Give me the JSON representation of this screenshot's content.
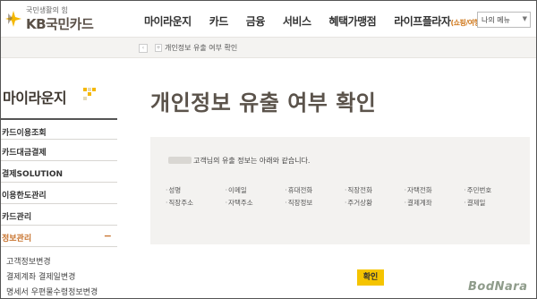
{
  "header": {
    "logo_slogan": "국민생활의 힘",
    "logo_name": "KB국민카드",
    "nav": [
      {
        "label": "마이라운지"
      },
      {
        "label": "카드"
      },
      {
        "label": "금융"
      },
      {
        "label": "서비스"
      },
      {
        "label": "혜택가맹점"
      },
      {
        "label": "라이프플라자",
        "sub": "(쇼핑/여행)"
      }
    ],
    "my_menu": "나의 메뉴",
    "accent_color": "#f5b800"
  },
  "breadcrumb": {
    "current": "개인정보 유출 여부 확인"
  },
  "sidebar": {
    "title": "마이라운지",
    "items": [
      {
        "label": "카드이용조회"
      },
      {
        "label": "카드대금결제"
      },
      {
        "label": "결제SOLUTION"
      },
      {
        "label": "이용한도관리"
      },
      {
        "label": "카드관리"
      },
      {
        "label": "정보관리"
      }
    ],
    "subitems": [
      {
        "label": "고객정보변경"
      },
      {
        "label": "결제계좌 결제일변경"
      },
      {
        "label": "명세서 우편물수령정보변경"
      }
    ]
  },
  "main": {
    "title": "개인정보 유출 여부 확인",
    "message": "고객님의 유출 정보는 아래와 같습니다.",
    "fields": [
      "성명",
      "이메일",
      "휴대전화",
      "직장전화",
      "자택전화",
      "주민번호",
      "직장주소",
      "자택주소",
      "직장정보",
      "주거상황",
      "결제계좌",
      "결제일"
    ],
    "confirm_label": "확인"
  },
  "watermark": "BodNara"
}
